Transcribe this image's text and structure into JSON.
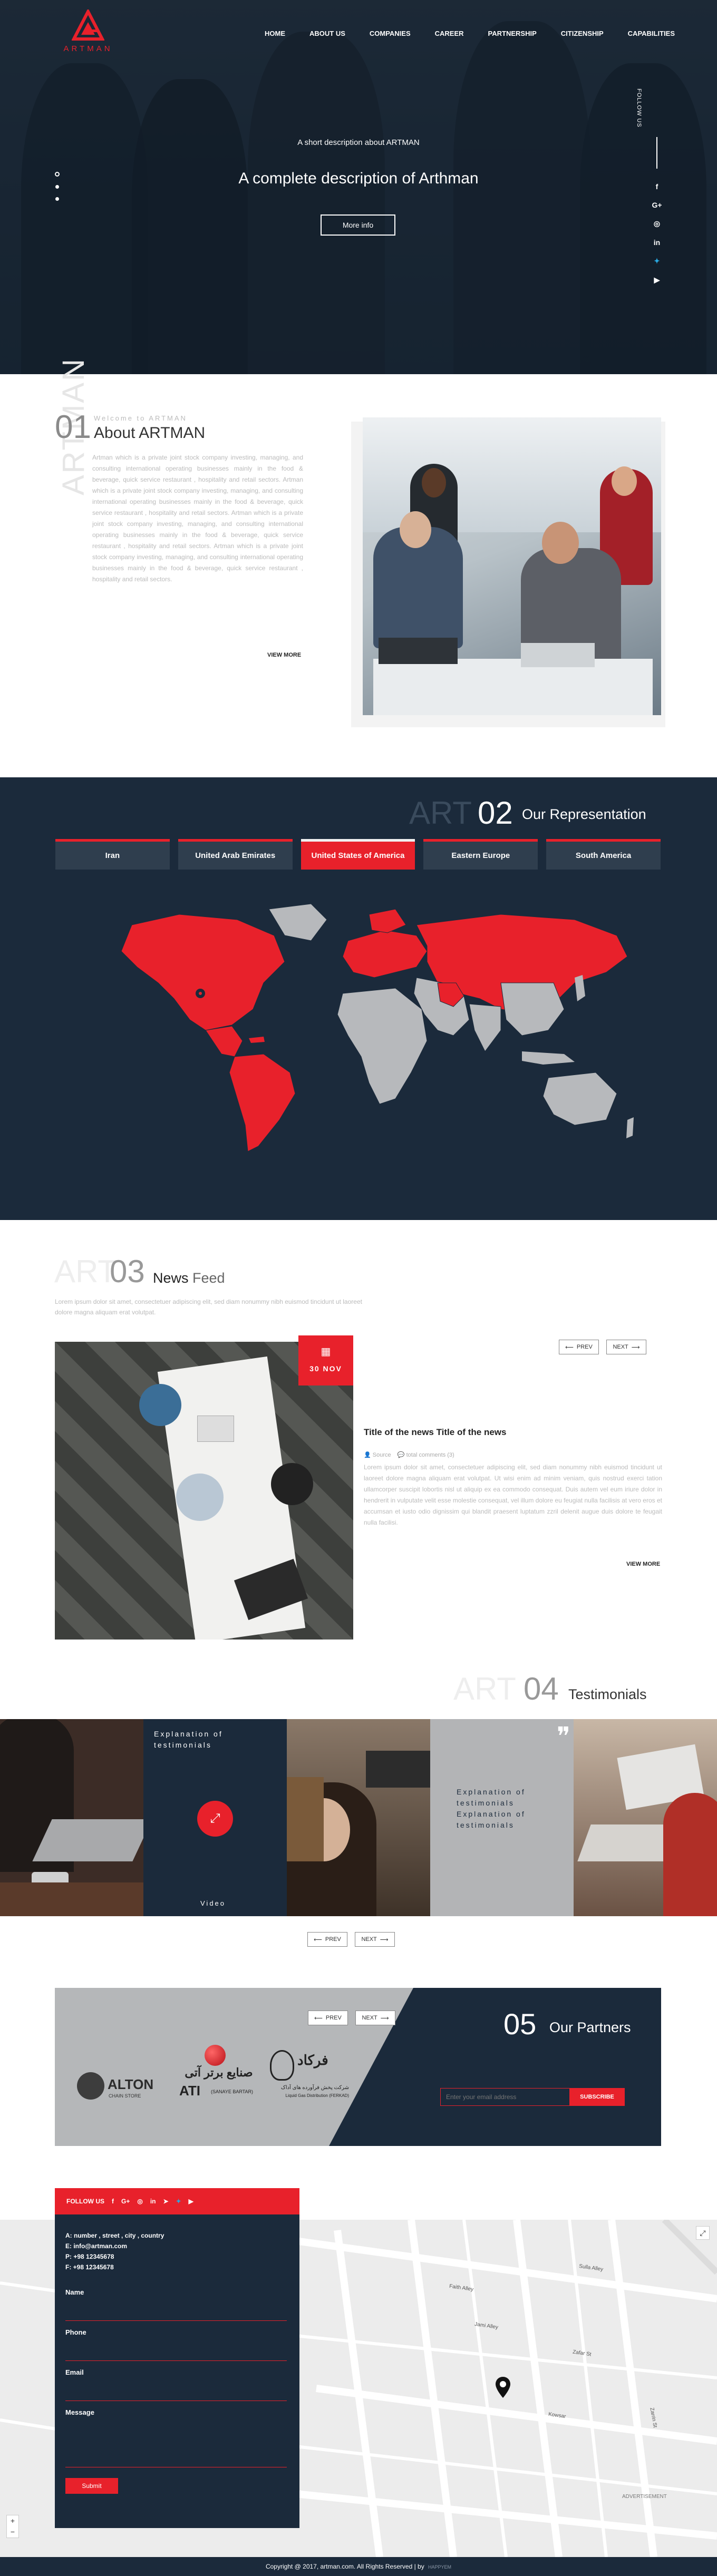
{
  "brand": {
    "name": "ARTMAN",
    "accent": "#e8212b",
    "dark": "#1b2a3b"
  },
  "nav": [
    "HOME",
    "ABOUT US",
    "COMPANIES",
    "CAREER",
    "PARTNERSHIP",
    "CITIZENSHIP",
    "CAPABILITIES"
  ],
  "hero": {
    "subtitle": "A short description about ARTMAN",
    "title": "A complete description of Arthman",
    "button": "More info",
    "follow_label": "FOLLOW US",
    "social_icons": [
      "facebook-icon",
      "google-plus-icon",
      "instagram-icon",
      "linkedin-icon",
      "twitter-icon",
      "youtube-icon"
    ]
  },
  "about": {
    "vertical": "ARTMAN",
    "number": "01",
    "welcome": "Welcome to ARTMAN",
    "title": "About ARTMAN",
    "text": "Artman which is a private joint stock company investing, managing, and consulting international operating businesses mainly in the food & beverage, quick service restaurant , hospitality and retail sectors. Artman which is a private joint stock company investing, managing, and consulting international operating businesses mainly in the food & beverage, quick service restaurant , hospitality and retail sectors. Artman which is a private joint stock company investing, managing, and consulting international operating businesses mainly in the food & beverage, quick service restaurant , hospitality and retail sectors. Artman which is a private joint stock company investing, managing, and consulting international operating businesses mainly in the food & beverage, quick service restaurant , hospitality and retail sectors.",
    "view_more": "VIEW MORE"
  },
  "representation": {
    "bg_word": "ART",
    "number": "02",
    "title": "Our Representation",
    "tabs": [
      "Iran",
      "United Arab Emirates",
      "United States of America",
      "Eastern Europe",
      "South America"
    ],
    "active_tab": 2
  },
  "news": {
    "bg_word": "ART",
    "number": "03",
    "title_a": "News",
    "title_b": "Feed",
    "subtitle": "Lorem ipsum dolor sit amet, consectetuer adipiscing elit, sed diam nonummy nibh euismod tincidunt ut laoreet dolore magna aliquam erat volutpat.",
    "date": "30 NOV",
    "prev": "PREV",
    "next": "NEXT",
    "article_title": "Title of the news Title of the news",
    "author": "Source",
    "comments": "total comments (3)",
    "body": "Lorem ipsum dolor sit amet, consectetuer adipiscing elit, sed diam nonummy nibh euismod tincidunt ut laoreet dolore magna aliquam erat volutpat. Ut wisi enim ad minim veniam, quis nostrud exerci tation ullamcorper suscipit lobortis nisl ut aliquip ex ea commodo consequat. Duis autem vel eum iriure dolor in hendrerit in vulputate velit esse molestie consequat, vel illum dolore eu feugiat nulla facilisis at vero eros et accumsan et iusto odio dignissim qui blandit praesent luptatum zzril delenit augue duis dolore te feugait nulla facilisi.",
    "view_more": "VIEW MORE"
  },
  "testimonials": {
    "bg_word": "ART",
    "number": "04",
    "title": "Testimonials",
    "panel_text_1": "Explanation of testimonials",
    "video_label": "Video",
    "panel_text_2": "Explanation of testimonials Explanation of testimonials",
    "prev": "PREV",
    "next": "NEXT"
  },
  "partners": {
    "number": "05",
    "title": "Our Partners",
    "prev": "PREV",
    "next": "NEXT",
    "email_placeholder": "Enter your email address",
    "subscribe": "SUBSCRIBE",
    "logos": [
      "ALTON",
      "ATI",
      "فرکاد"
    ],
    "logo_subs": [
      "CHAIN STORE",
      "صنایع برتر آتی",
      "(SANAYE BARTAR)",
      "شرکت پخش فرآورده های آداک",
      "Liquid Gas Distribution (FERKAD)"
    ]
  },
  "contact": {
    "follow_label": "FOLLOW US",
    "social_icons": [
      "facebook-icon",
      "google-plus-icon",
      "instagram-icon",
      "linkedin-icon",
      "telegram-icon",
      "twitter-icon",
      "youtube-icon"
    ],
    "address": "A:  number , street , city , country",
    "email": "E:  info@artman.com",
    "phone": "P:  +98 12345678",
    "fax": "F:  +98 12345678",
    "fields": [
      "Name",
      "Phone",
      "Email",
      "Message"
    ],
    "submit": "Submit"
  },
  "map_labels": [
    "Sulla Alley",
    "Faith Alley",
    "Jami Alley",
    "Zafar St",
    "Zarrin St",
    "Kowsar",
    "ADVERTISEMENT"
  ],
  "footer": {
    "text": "Copyright @ 2017, artman.com. All Rights Reserved | by",
    "credit": "HAPPYEM"
  }
}
